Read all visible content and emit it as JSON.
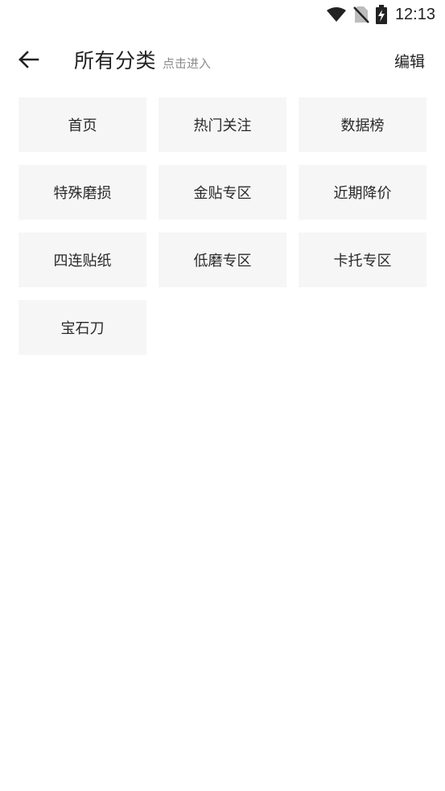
{
  "status_bar": {
    "time": "12:13",
    "icons": [
      "wifi-icon",
      "no-sim-icon",
      "battery-charging-icon"
    ]
  },
  "header": {
    "back_icon": "arrow-left-icon",
    "title": "所有分类",
    "subtitle": "点击进入",
    "edit_label": "编辑"
  },
  "categories": [
    {
      "label": "首页"
    },
    {
      "label": "热门关注"
    },
    {
      "label": "数据榜"
    },
    {
      "label": "特殊磨损"
    },
    {
      "label": "金贴专区"
    },
    {
      "label": "近期降价"
    },
    {
      "label": "四连贴纸"
    },
    {
      "label": "低磨专区"
    },
    {
      "label": "卡托专区"
    },
    {
      "label": "宝石刀"
    }
  ]
}
